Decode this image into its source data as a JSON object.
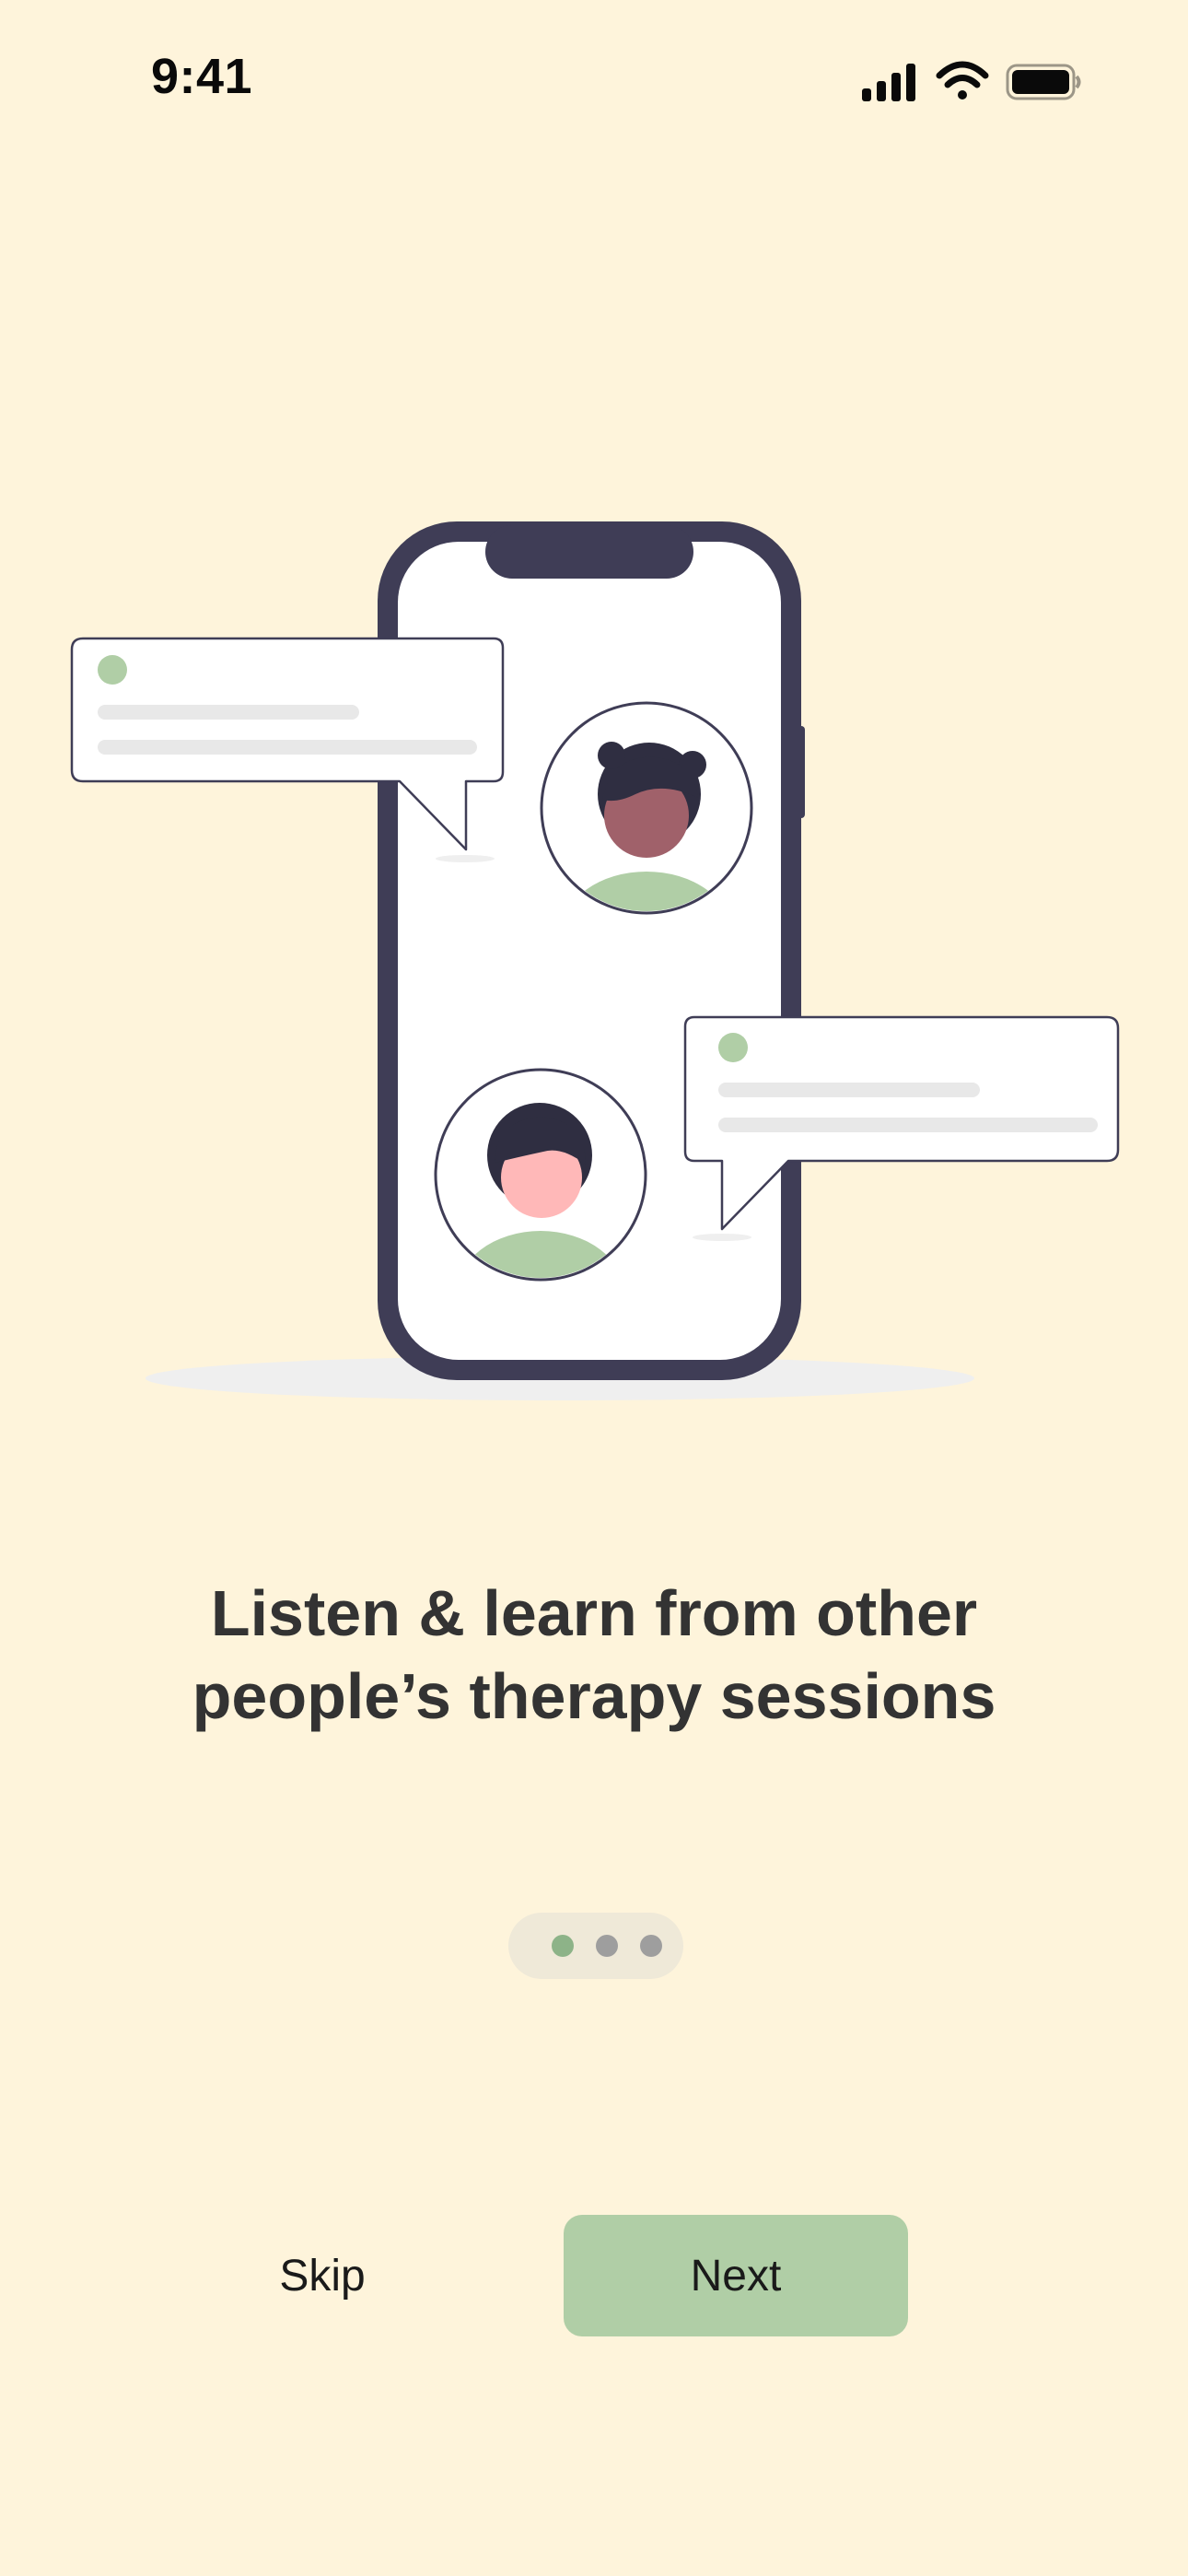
{
  "status_bar": {
    "time": "9:41",
    "icons": [
      "cellular-signal-icon",
      "wifi-icon",
      "battery-icon"
    ]
  },
  "illustration": {
    "name": "phone-chat-illustration",
    "colors": {
      "phone_frame": "#3F3D56",
      "screen": "#FFFFFF",
      "bubble_dot": "#B0CEA6",
      "bubble_line": "#E8E8E8",
      "shadow": "#EFEFEF",
      "shirt": "#B0CEA6",
      "skin_woman": "#A0616A",
      "skin_man": "#FFB8B8",
      "hair": "#2F2E41"
    }
  },
  "onboarding": {
    "headline_line1": "Listen & learn from other",
    "headline_line2": "people’s therapy sessions"
  },
  "pager": {
    "total_pages": 3,
    "current_page": 1,
    "active_color": "#8DB388",
    "inactive_color": "#9E9E9E"
  },
  "actions": {
    "skip_label": "Skip",
    "next_label": "Next"
  },
  "colors": {
    "background": "#FEF4DB",
    "accent": "#B0CEA6",
    "headline": "#333333"
  }
}
